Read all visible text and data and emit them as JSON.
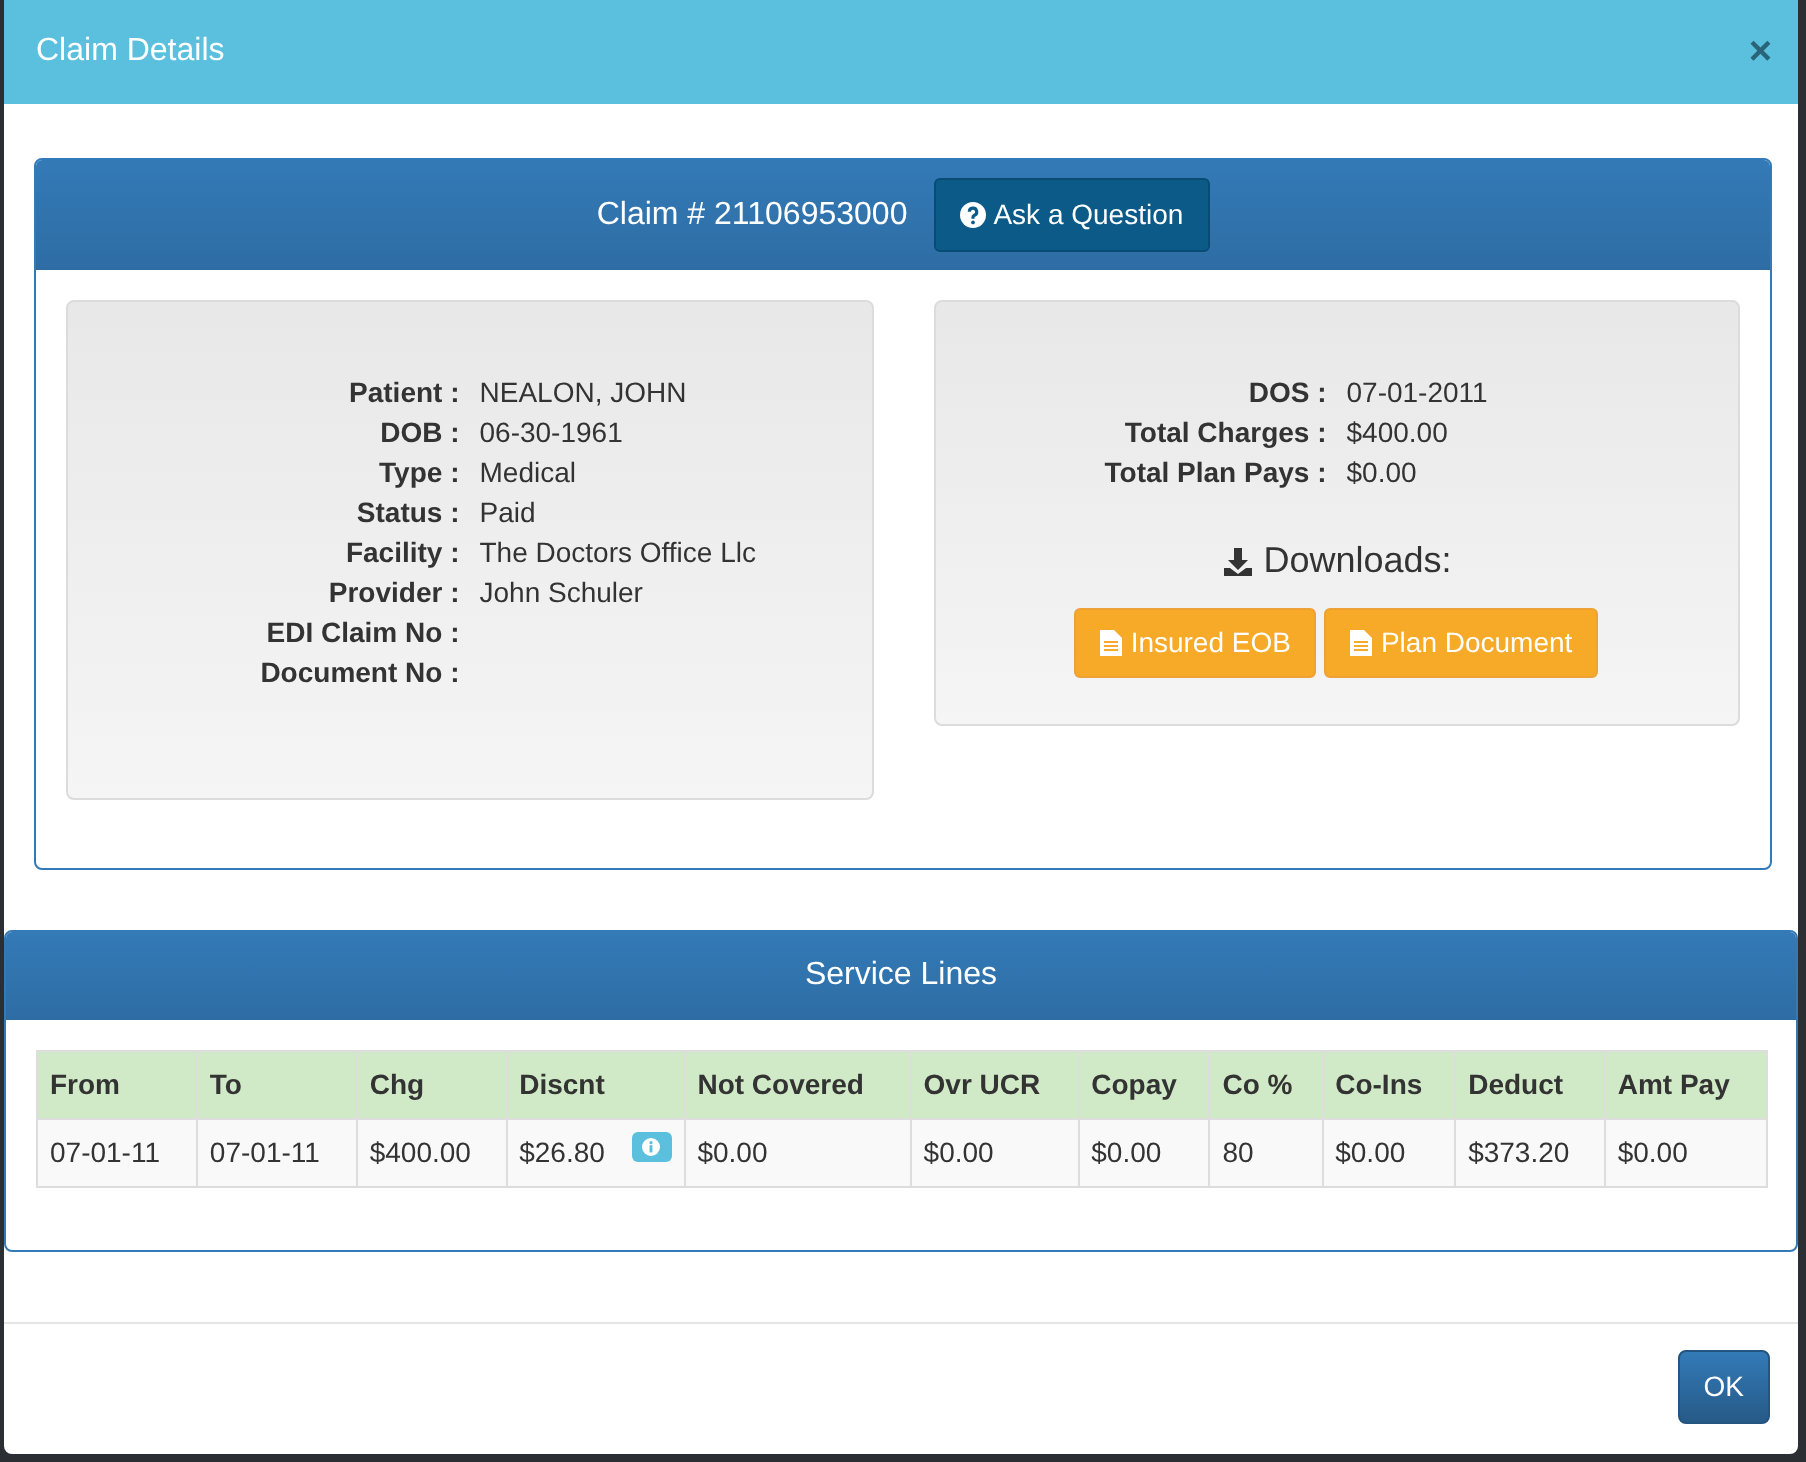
{
  "modal": {
    "title": "Claim Details",
    "close": "×"
  },
  "claim": {
    "heading": "Claim # 21106953000",
    "ask_button": "Ask a Question",
    "left_fields": [
      {
        "label": "Patient :",
        "value": "NEALON, JOHN"
      },
      {
        "label": "DOB :",
        "value": "06-30-1961"
      },
      {
        "label": "Type :",
        "value": "Medical"
      },
      {
        "label": "Status :",
        "value": "Paid"
      },
      {
        "label": "Facility :",
        "value": "The Doctors Office Llc"
      },
      {
        "label": "Provider :",
        "value": "John Schuler"
      },
      {
        "label": "EDI Claim No :"
      },
      {
        "label": "Document No :"
      }
    ],
    "right_fields": [
      {
        "label": "DOS :",
        "value": "07-01-2011"
      },
      {
        "label": "Total Charges :",
        "value": "$400.00"
      },
      {
        "label": "Total Plan Pays :",
        "value": "$0.00"
      }
    ],
    "downloads_title": "Downloads:",
    "downloads": [
      "Insured EOB",
      "Plan Document"
    ]
  },
  "service_lines": {
    "title": "Service Lines",
    "columns": [
      "From",
      "To",
      "Chg",
      "Discnt",
      "Not Covered",
      "Ovr UCR",
      "Copay",
      "Co %",
      "Co-Ins",
      "Deduct",
      "Amt Pay"
    ],
    "rows": [
      {
        "cells": [
          {
            "text": "07-01-11"
          },
          {
            "text": "07-01-11"
          },
          {
            "text": "$400.00"
          },
          {
            "text": "$26.80",
            "info": true
          },
          {
            "text": "$0.00"
          },
          {
            "text": "$0.00"
          },
          {
            "text": "$0.00"
          },
          {
            "text": "80"
          },
          {
            "text": "$0.00"
          },
          {
            "text": "$373.20"
          },
          {
            "text": "$0.00"
          }
        ]
      }
    ]
  },
  "footer": {
    "ok_button": "OK"
  }
}
